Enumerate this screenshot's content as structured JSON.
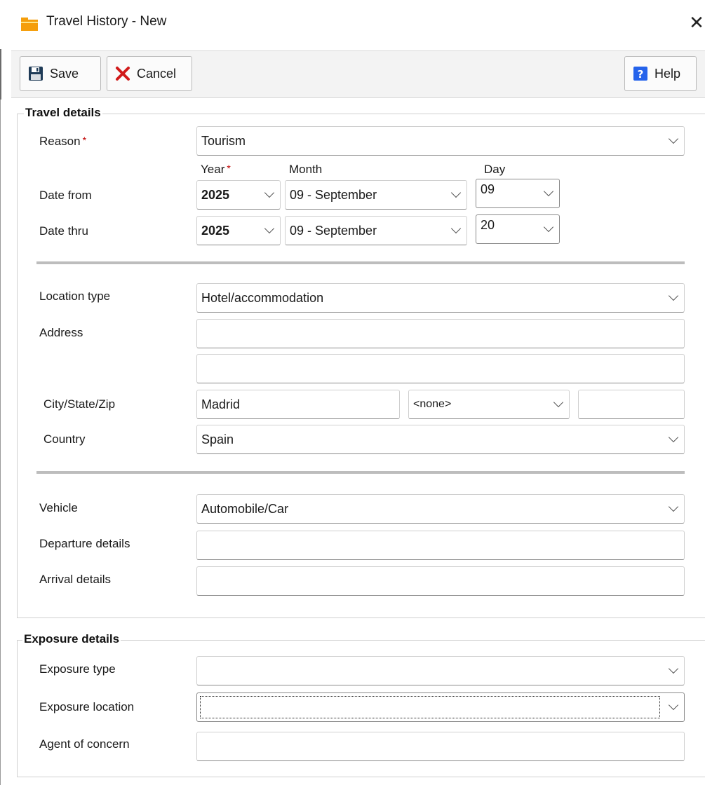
{
  "window": {
    "title": "Travel History - New",
    "close_glyph": "✕",
    "title_icon": "folder-icon",
    "accent": "#f59e0b"
  },
  "toolbar": {
    "save_label": "Save",
    "cancel_label": "Cancel",
    "help_label": "Help"
  },
  "travel": {
    "group_title": "Travel details",
    "reason_label": "Reason",
    "reason_value": "Tourism",
    "col_year": "Year",
    "col_month": "Month",
    "col_day": "Day",
    "date_from_label": "Date from",
    "date_from": {
      "year": "2025",
      "month": "09 - September",
      "day": "09"
    },
    "date_thru_label": "Date thru",
    "date_thru": {
      "year": "2025",
      "month": "09 - September",
      "day": "20"
    },
    "location_type_label": "Location type",
    "location_type_value": "Hotel/accommodation",
    "address_label": "Address",
    "address_line1": "",
    "address_line2": "",
    "city_state_zip_label": "City/State/Zip",
    "city_value": "Madrid",
    "state_value": "<none>",
    "zip_value": "",
    "country_label": "Country",
    "country_value": "Spain",
    "vehicle_label": "Vehicle",
    "vehicle_value": "Automobile/Car",
    "departure_label": "Departure details",
    "departure_value": "",
    "arrival_label": "Arrival details",
    "arrival_value": ""
  },
  "exposure": {
    "group_title": "Exposure details",
    "type_label": "Exposure type",
    "type_value": "",
    "location_label": "Exposure location",
    "location_value": "",
    "agent_label": "Agent of concern",
    "agent_value": ""
  },
  "required_marker": "*"
}
